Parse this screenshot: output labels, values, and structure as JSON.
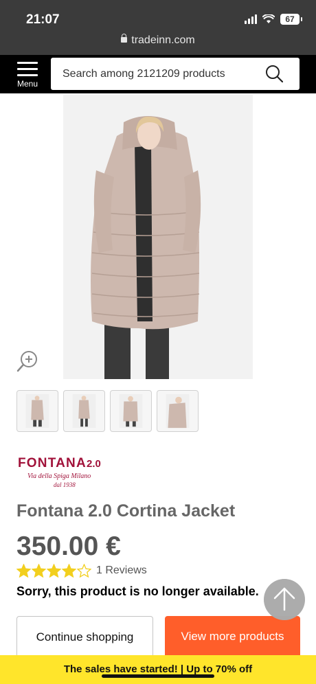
{
  "status_bar": {
    "time": "21:07",
    "battery": "67",
    "url": "tradeinn.com"
  },
  "header": {
    "menu_label": "Menu",
    "search_placeholder": "Search among 2121209 products"
  },
  "product": {
    "brand": "FONTANA 2.0",
    "brand_tagline": "Via della Spiga Milano",
    "brand_since": "dal 1938",
    "title": "Fontana 2.0 Cortina Jacket",
    "price": "350.00 €",
    "rating": 4,
    "rating_max": 5,
    "reviews": "1 Reviews",
    "availability": "Sorry, this product is no longer available."
  },
  "thumbnails": [
    "thumb-front",
    "thumb-full",
    "thumb-hood",
    "thumb-side"
  ],
  "buttons": {
    "continue": "Continue shopping",
    "view_more": "View more products"
  },
  "promo": {
    "text": "The sales have started! | Up to 70% off"
  },
  "colors": {
    "header_bg": "#000000",
    "status_bg": "#3b3b3b",
    "accent": "#ff5e2a",
    "promo_bg": "#ffe52b",
    "star": "#f2cf1e"
  }
}
